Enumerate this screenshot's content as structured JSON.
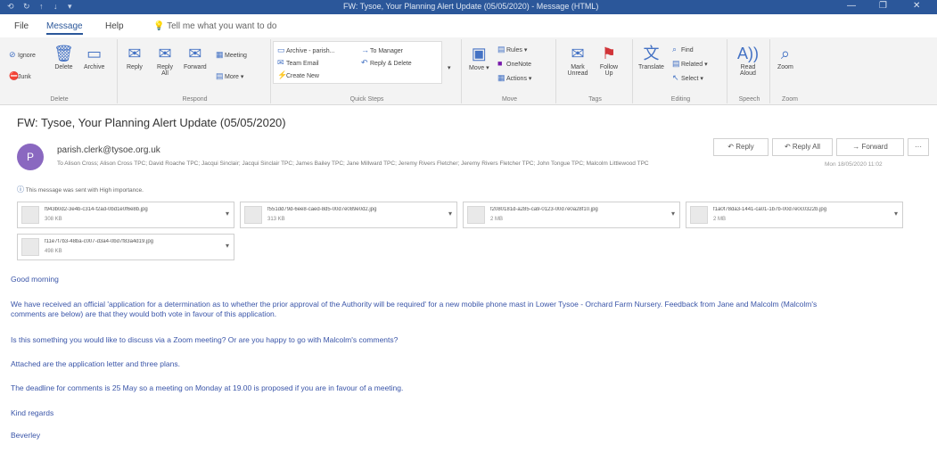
{
  "window": {
    "title": "FW: Tysoe, Your Planning Alert Update (05/05/2020) - Message (HTML)",
    "quick_access": [
      "⟲",
      "↻",
      "↑",
      "↓",
      "▾"
    ],
    "controls": [
      "—",
      "❐",
      "✕"
    ]
  },
  "tabs": [
    "File",
    "Message",
    "Help"
  ],
  "tell_me": "Tell me what you want to do",
  "ribbon": {
    "delete": {
      "ignore": "Ignore",
      "junk": "Junk",
      "delete": "Delete",
      "archive": "Archive",
      "label": "Delete"
    },
    "respond": {
      "reply": "Reply",
      "reply_all": "Reply All",
      "forward": "Forward",
      "meeting": "Meeting",
      "more": "More",
      "label": "Respond"
    },
    "quick_steps": {
      "items": [
        "Archive - parish...",
        "Team Email",
        "Create New",
        "To Manager",
        "Reply & Delete"
      ],
      "label": "Quick Steps"
    },
    "move": {
      "move": "Move",
      "rules": "Rules",
      "onenote": "OneNote",
      "actions": "Actions",
      "label": "Move"
    },
    "tags": {
      "unread": "Mark Unread",
      "follow": "Follow Up",
      "label": "Tags"
    },
    "editing": {
      "translate": "Translate",
      "find": "Find",
      "related": "Related",
      "select": "Select",
      "label": "Editing"
    },
    "speech": {
      "read": "Read Aloud",
      "label": "Speech"
    },
    "zoom": {
      "zoom": "Zoom",
      "label": "Zoom"
    }
  },
  "message": {
    "subject": "FW: Tysoe, Your Planning Alert Update (05/05/2020)",
    "avatar_letter": "P",
    "sender": "parish.clerk@tysoe.org.uk",
    "to": "To  Alison Cross; Alison Cross TPC; David Roache TPC; Jacqui Sinclair; Jacqui Sinclair TPC; James Bailey TPC; Jane Millward TPC; Jeremy Rivers Fletcher; Jeremy Rivers Fletcher TPC; John Tongue TPC; Malcolm Littlewood TPC",
    "date": "Mon 18/05/2020 11:02",
    "actions": {
      "reply": "↶ Reply",
      "reply_all": "↶ Reply All",
      "forward": "→ Forward",
      "more": "···"
    },
    "importance": "This message was sent with High importance."
  },
  "attachments": [
    {
      "name": "f943b0d2-3e4b-c314-f2ad-0bd1e0f6e8b.jpg",
      "size": "308 KB"
    },
    {
      "name": "f551dd79d-6ee8-caed-8d5-00d7e089e0d2.jpg",
      "size": "313 KB"
    },
    {
      "name": "f2080181d-a285-ca9-0123-00d7e0a28f10.jpg",
      "size": "2 MB"
    },
    {
      "name": "f1a0f78da3-1441-ca01-1b7b-00d7e0c0322b.jpg",
      "size": "2 MB"
    },
    {
      "name": "f11e7f7b3-48ba-c007-d3a4-0bd7f83a4d19.jpg",
      "size": "498 KB"
    }
  ],
  "body": [
    "Good morning",
    "We have received an official 'application for a determination as to whether the prior approval of the Authority will be required' for a new mobile phone mast in Lower Tysoe - Orchard Farm Nursery.  Feedback from Jane and Malcolm (Malcolm's comments are below) are that they would both vote in favour of this application.",
    "Is this something you would like to discuss via a Zoom meeting?  Or are you happy to go with Malcolm's comments?",
    "Attached are the application letter and three plans.",
    "The deadline for comments is 25 May so a meeting on Monday at 19.00 is proposed if you are in favour of a meeting.",
    "Kind regards",
    "Beverley"
  ]
}
